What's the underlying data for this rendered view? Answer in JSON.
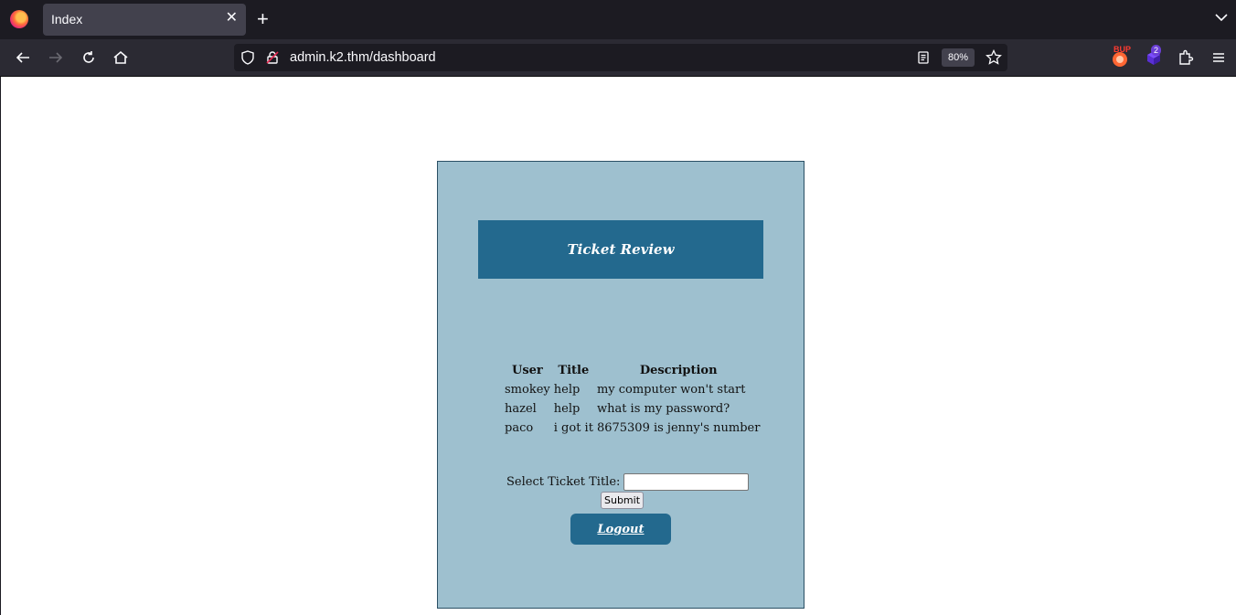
{
  "browser": {
    "tab_title": "Index",
    "url": "admin.k2.thm/dashboard",
    "zoom": "80%",
    "extension_badge": "2",
    "burp_label": "BUP"
  },
  "page": {
    "header_title": "Ticket Review",
    "table": {
      "headers": [
        "User",
        "Title",
        "Description"
      ],
      "rows": [
        {
          "user": "smokey",
          "title": "help",
          "description": "my computer won't start"
        },
        {
          "user": "hazel",
          "title": "help",
          "description": "what is my password?"
        },
        {
          "user": "paco",
          "title": "i got it",
          "description": "8675309 is jenny's number"
        }
      ]
    },
    "form": {
      "label": "Select Ticket Title:",
      "input_value": "",
      "submit_label": "Submit"
    },
    "logout_label": "Logout"
  },
  "colors": {
    "panel_bg": "#9ec0cf",
    "header_bg": "#23698e",
    "browser_bg": "#1c1b22"
  }
}
